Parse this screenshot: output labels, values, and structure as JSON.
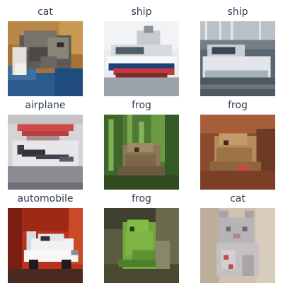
{
  "grid": {
    "images": [
      {
        "label": "cat",
        "subject": "cat-photo"
      },
      {
        "label": "ship",
        "subject": "ship-photo"
      },
      {
        "label": "ship",
        "subject": "ship-photo"
      },
      {
        "label": "airplane",
        "subject": "airplane-photo"
      },
      {
        "label": "frog",
        "subject": "frog-photo"
      },
      {
        "label": "frog",
        "subject": "frog-photo"
      },
      {
        "label": "automobile",
        "subject": "automobile-photo"
      },
      {
        "label": "frog",
        "subject": "frog-photo"
      },
      {
        "label": "cat",
        "subject": "cat-photo"
      }
    ]
  },
  "colors": {
    "label_text": "#2e3c52",
    "background": "#ffffff"
  }
}
